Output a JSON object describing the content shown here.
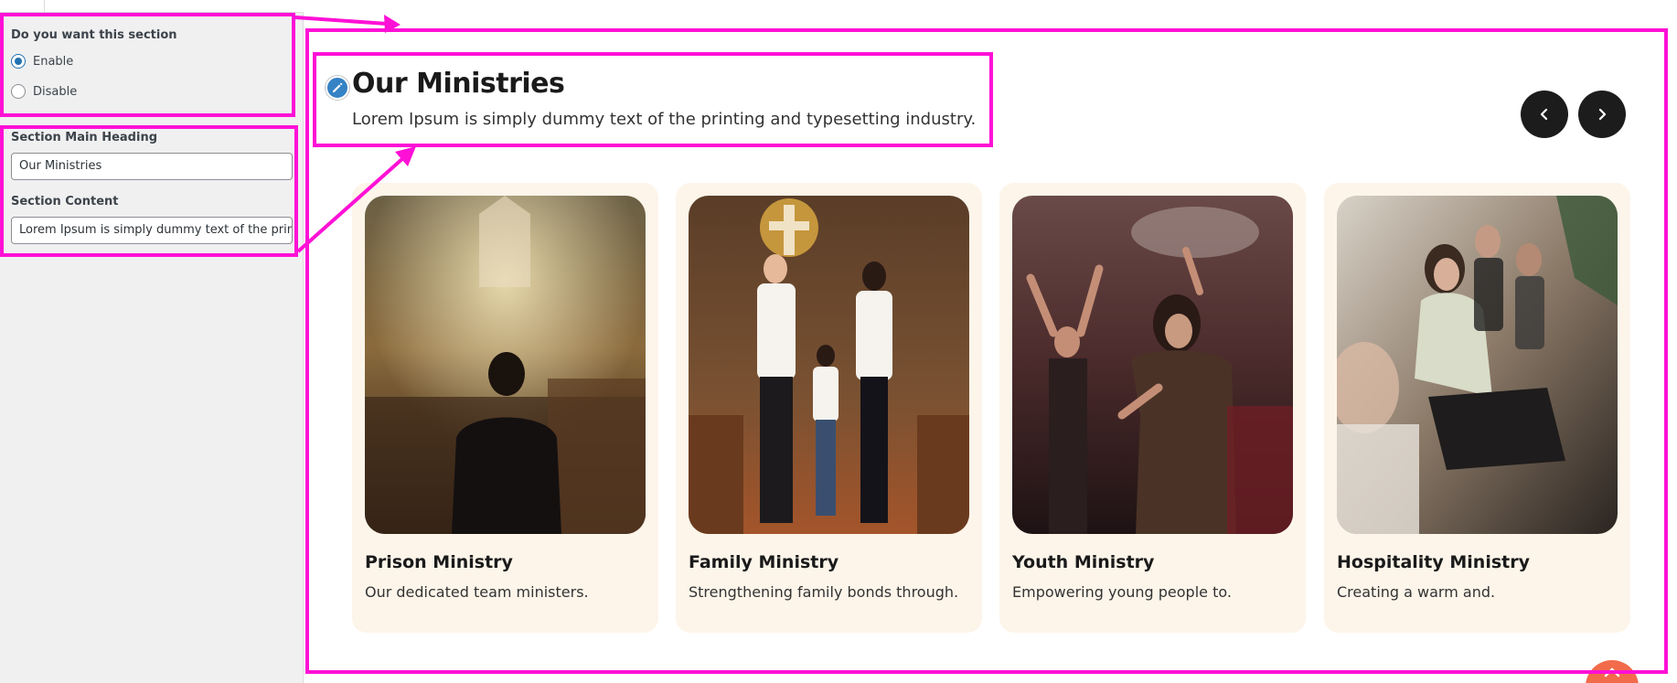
{
  "sidebar": {
    "section_toggle_label": "Do you want this section",
    "options": [
      {
        "label": "Enable",
        "checked": true
      },
      {
        "label": "Disable",
        "checked": false
      }
    ],
    "heading_field_label": "Section Main Heading",
    "heading_field_value": "Our Ministries",
    "content_field_label": "Section Content",
    "content_field_value": "Lorem Ipsum is simply dummy text of the printing and typesetting industry."
  },
  "section": {
    "title": "Our Ministries",
    "subtitle": "Lorem Ipsum is simply dummy text of the printing and typesetting industry.",
    "prev_icon": "chevron-left-icon",
    "next_icon": "chevron-right-icon"
  },
  "cards": [
    {
      "title": "Prison Ministry",
      "description": "Our dedicated team ministers."
    },
    {
      "title": "Family Ministry",
      "description": "Strengthening family bonds through."
    },
    {
      "title": "Youth Ministry",
      "description": "Empowering young people to."
    },
    {
      "title": "Hospitality Ministry",
      "description": "Creating a warm and."
    }
  ],
  "colors": {
    "annotation": "#ff10d6",
    "card_bg": "#fdf5ea",
    "nav_button": "#1c1c1c",
    "radio_accent": "#2271b1",
    "scroll_top": "#f26b4b"
  }
}
